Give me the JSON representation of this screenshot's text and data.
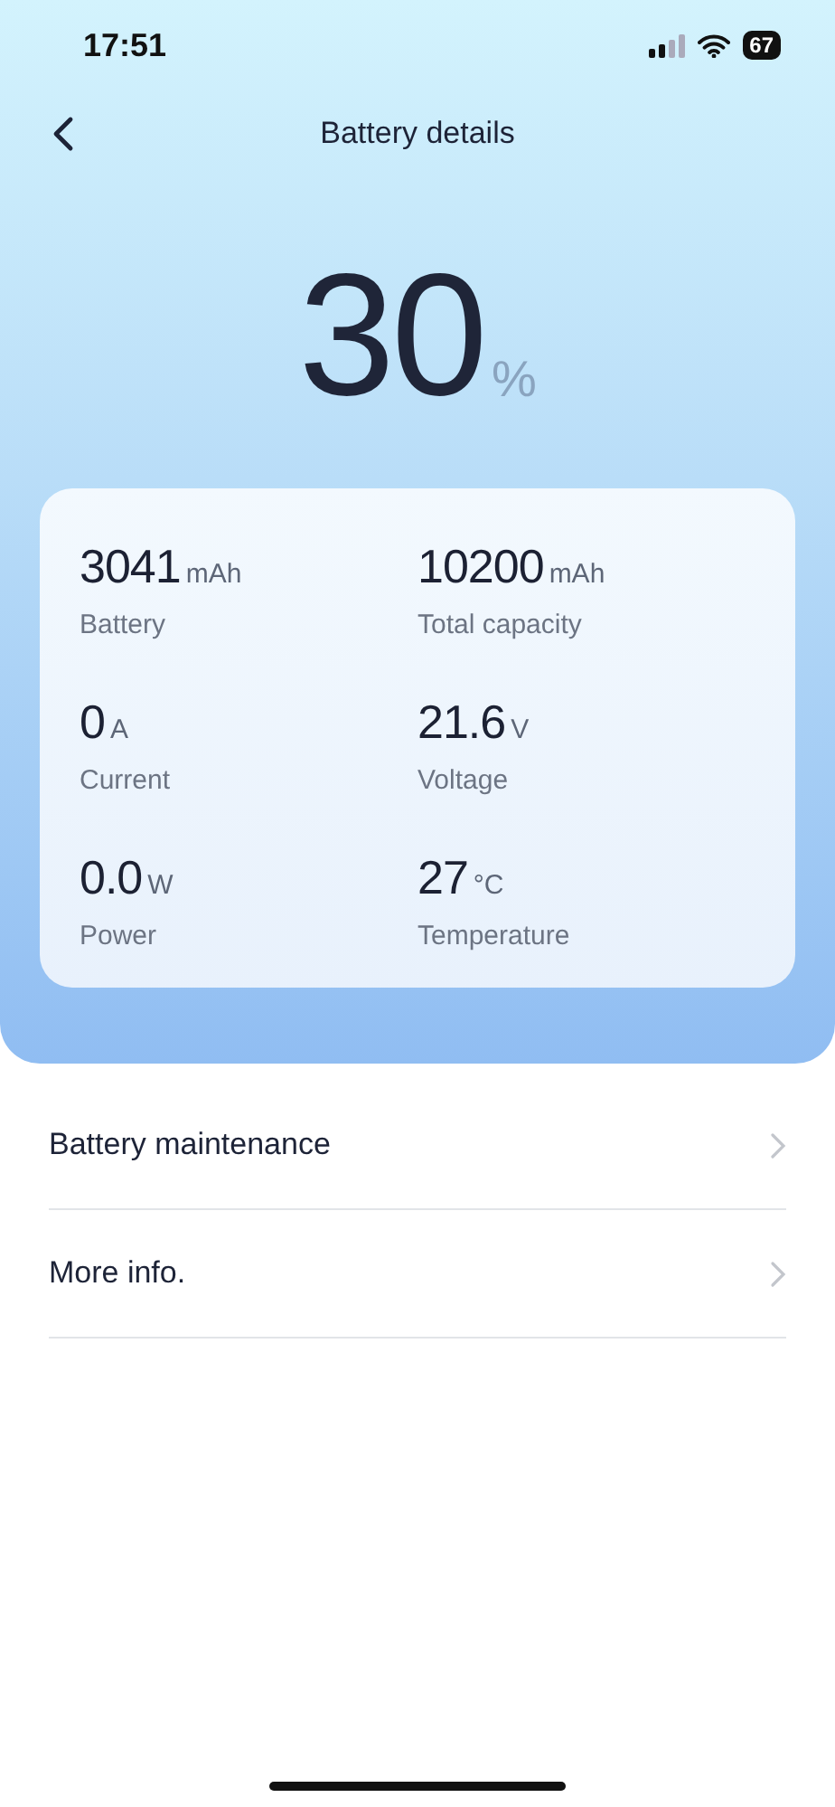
{
  "status_bar": {
    "time": "17:51",
    "battery": "67"
  },
  "header": {
    "title": "Battery details"
  },
  "charge": {
    "value": "30",
    "unit": "%"
  },
  "stats": [
    {
      "value": "3041",
      "unit": "mAh",
      "label": "Battery"
    },
    {
      "value": "10200",
      "unit": "mAh",
      "label": "Total capacity"
    },
    {
      "value": "0",
      "unit": "A",
      "label": "Current"
    },
    {
      "value": "21.6",
      "unit": "V",
      "label": "Voltage"
    },
    {
      "value": "0.0",
      "unit": "W",
      "label": "Power"
    },
    {
      "value": "27",
      "unit": "°C",
      "label": "Temperature"
    }
  ],
  "menu": [
    {
      "label": "Battery maintenance"
    },
    {
      "label": "More info."
    }
  ]
}
